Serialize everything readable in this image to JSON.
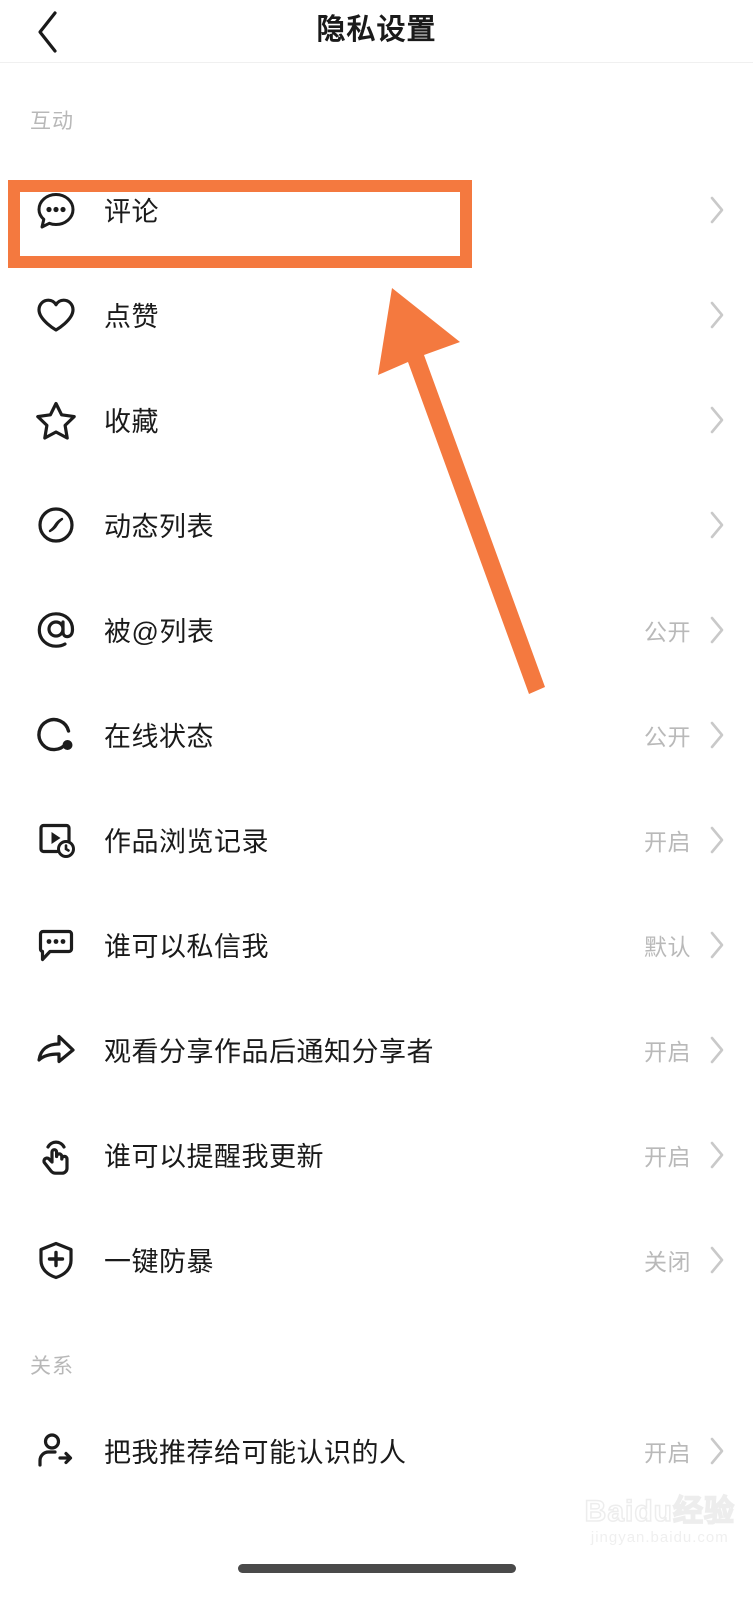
{
  "header": {
    "title": "隐私设置",
    "back_icon": "chevron-left-icon"
  },
  "sections": [
    {
      "key": "interaction",
      "title": "互动",
      "items": [
        {
          "icon": "comment-bubble-icon",
          "label": "评论",
          "value": "",
          "chevron": "chevron-right-icon",
          "highlighted": true
        },
        {
          "icon": "heart-icon",
          "label": "点赞",
          "value": "",
          "chevron": "chevron-right-icon"
        },
        {
          "icon": "star-icon",
          "label": "收藏",
          "value": "",
          "chevron": "chevron-right-icon"
        },
        {
          "icon": "compass-icon",
          "label": "动态列表",
          "value": "",
          "chevron": "chevron-right-icon"
        },
        {
          "icon": "at-sign-icon",
          "label": "被@列表",
          "value": "公开",
          "chevron": "chevron-right-icon"
        },
        {
          "icon": "online-status-icon",
          "label": "在线状态",
          "value": "公开",
          "chevron": "chevron-right-icon"
        },
        {
          "icon": "video-history-icon",
          "label": "作品浏览记录",
          "value": "开启",
          "chevron": "chevron-right-icon"
        },
        {
          "icon": "chat-bubble-icon",
          "label": "谁可以私信我",
          "value": "默认",
          "chevron": "chevron-right-icon"
        },
        {
          "icon": "share-arrow-icon",
          "label": "观看分享作品后通知分享者",
          "value": "开启",
          "chevron": "chevron-right-icon"
        },
        {
          "icon": "tap-hand-icon",
          "label": "谁可以提醒我更新",
          "value": "开启",
          "chevron": "chevron-right-icon"
        },
        {
          "icon": "shield-plus-icon",
          "label": "一键防暴",
          "value": "关闭",
          "chevron": "chevron-right-icon"
        }
      ]
    },
    {
      "key": "relation",
      "title": "关系",
      "items": [
        {
          "icon": "person-share-icon",
          "label": "把我推荐给可能认识的人",
          "value": "开启",
          "chevron": "chevron-right-icon"
        }
      ]
    }
  ],
  "annotation": {
    "highlight_color": "#f4793f",
    "arrow_color": "#f4793f",
    "target_label": "评论"
  },
  "watermark": {
    "main": "Baidu经验",
    "sub": "jingyan.baidu.com"
  }
}
